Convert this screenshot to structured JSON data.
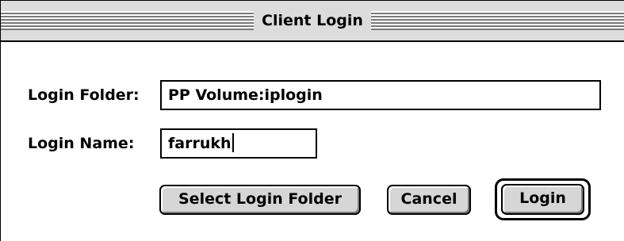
{
  "window": {
    "title": "Client Login"
  },
  "form": {
    "login_folder_label": "Login Folder:",
    "login_folder_value": "PP Volume:iplogin",
    "login_name_label": "Login Name:",
    "login_name_value": "farrukh"
  },
  "buttons": {
    "select_folder": "Select Login Folder",
    "cancel": "Cancel",
    "login": "Login"
  }
}
